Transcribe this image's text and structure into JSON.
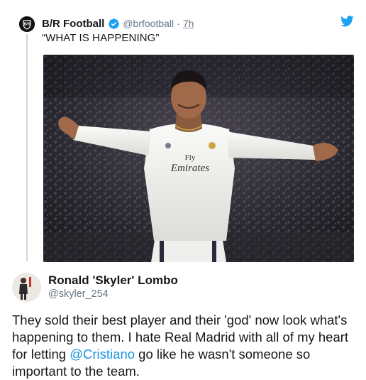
{
  "parent": {
    "name": "B/R Football",
    "handle": "@brfootball",
    "separator": "·",
    "time": "7h",
    "text": "“WHAT IS HAPPENING”",
    "avatar_icon": "br-football-logo-icon",
    "brand_icon": "twitter-bird-icon",
    "media": {
      "shirt_text_1": "Fly",
      "shirt_text_2": "Emirates",
      "colors": {
        "background": "#2a2b33",
        "kit": "#f2f2f0",
        "skin": "#a06a4a"
      }
    }
  },
  "reply": {
    "name": "Ronald 'Skyler' Lombo",
    "handle": "@skyler_254",
    "text_before": "They sold their best player and their 'god' now look what's happening to them. I hate Real Madrid with all of my heart for letting ",
    "mention": "@Cristiano",
    "text_after": " go like he wasn't someone so important to the team."
  },
  "colors": {
    "twitter_blue": "#1da1f2",
    "link": "#1b95e0",
    "secondary_text": "#657786",
    "thread_line": "#ccd6dd"
  }
}
